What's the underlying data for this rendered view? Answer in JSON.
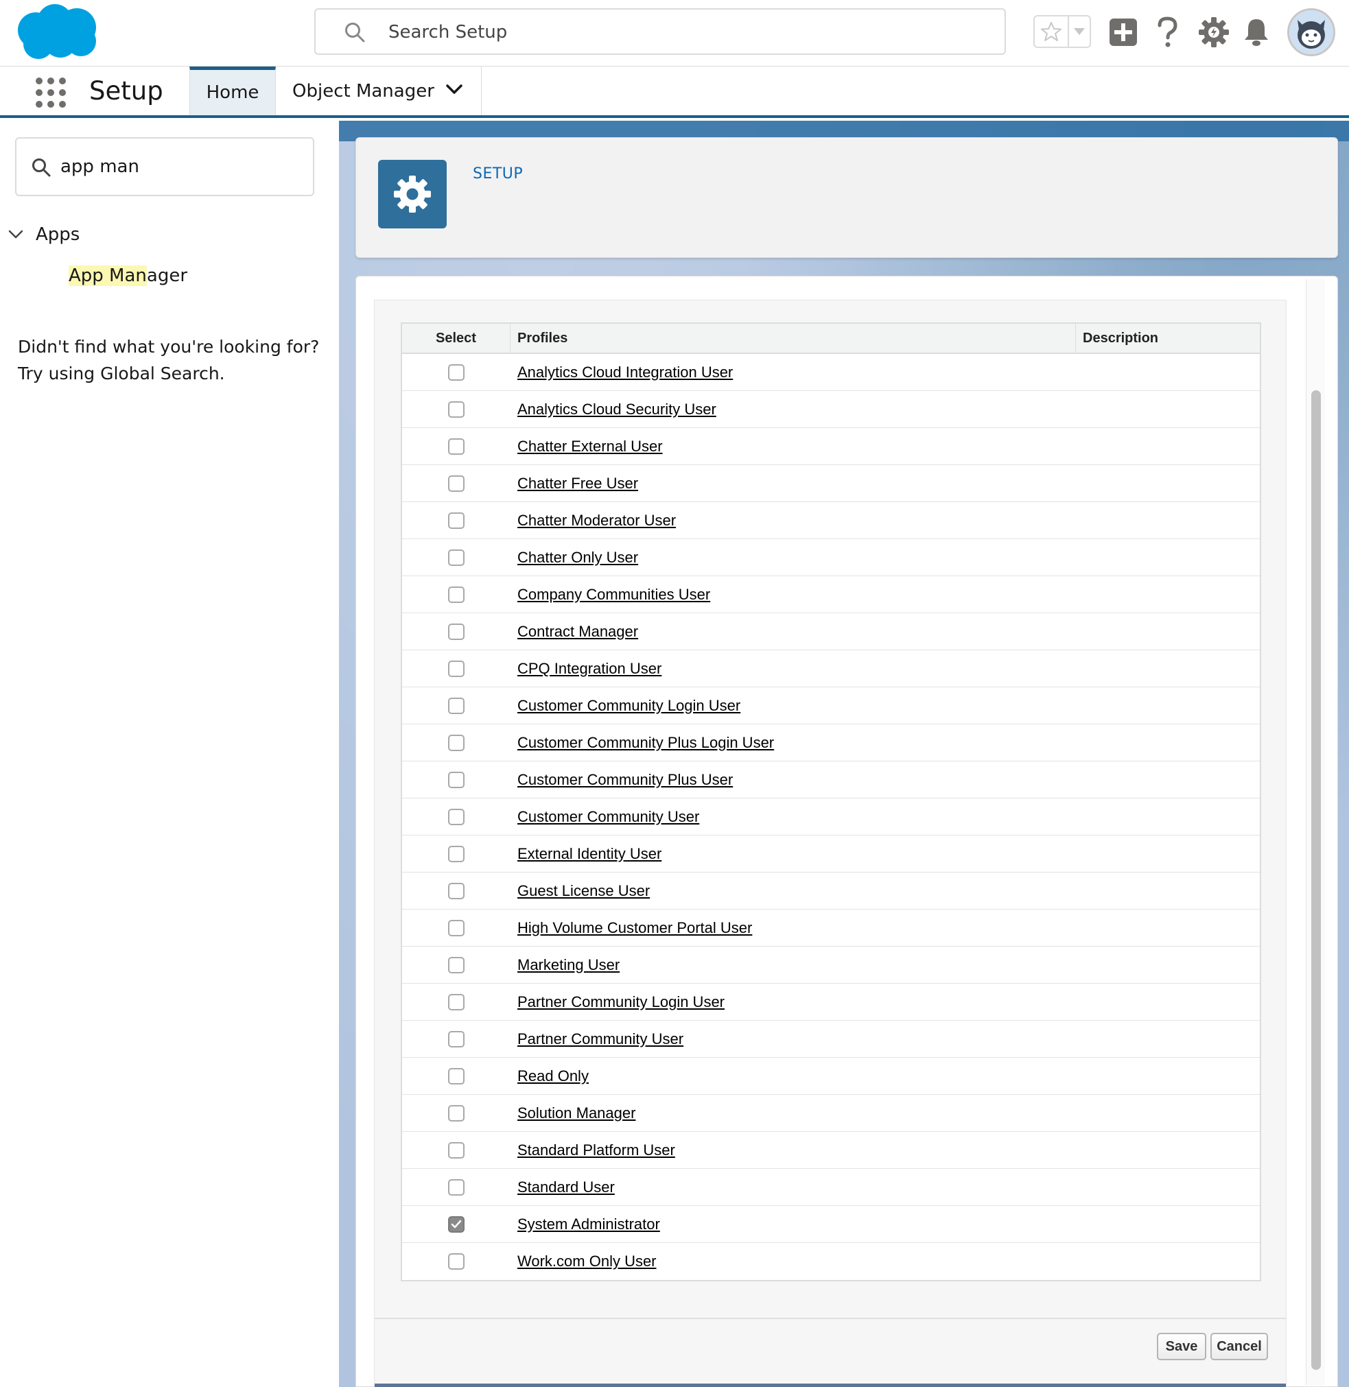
{
  "header": {
    "search_placeholder": "Search Setup",
    "brand_color": "#00a1e0",
    "icons": [
      "salesforce-logo",
      "search-icon",
      "star-icon",
      "chevron-down-icon",
      "plus-icon",
      "help-icon",
      "gear-icon",
      "bell-icon",
      "avatar"
    ]
  },
  "nav": {
    "app_name": "Setup",
    "tabs": [
      {
        "label": "Home",
        "active": true
      },
      {
        "label": "Object Manager",
        "active": false
      }
    ]
  },
  "sidebar": {
    "quick_find_value": "app man",
    "tree": {
      "section_label": "Apps",
      "item_highlight": "App Man",
      "item_rest": "ager"
    },
    "hint_line1": "Didn't find what you're looking for?",
    "hint_line2": "Try using Global Search."
  },
  "setup_header": {
    "breadcrumb": "SETUP"
  },
  "table": {
    "columns": [
      "Select",
      "Profiles",
      "Description"
    ],
    "rows": [
      {
        "profile": "Analytics Cloud Integration User",
        "checked": false
      },
      {
        "profile": "Analytics Cloud Security User",
        "checked": false
      },
      {
        "profile": "Chatter External User",
        "checked": false
      },
      {
        "profile": "Chatter Free User",
        "checked": false
      },
      {
        "profile": "Chatter Moderator User",
        "checked": false
      },
      {
        "profile": "Chatter Only User",
        "checked": false
      },
      {
        "profile": "Company Communities User",
        "checked": false
      },
      {
        "profile": "Contract Manager",
        "checked": false
      },
      {
        "profile": "CPQ Integration User",
        "checked": false
      },
      {
        "profile": "Customer Community Login User",
        "checked": false
      },
      {
        "profile": "Customer Community Plus Login User",
        "checked": false
      },
      {
        "profile": "Customer Community Plus User",
        "checked": false
      },
      {
        "profile": "Customer Community User",
        "checked": false
      },
      {
        "profile": "External Identity User",
        "checked": false
      },
      {
        "profile": "Guest License User",
        "checked": false
      },
      {
        "profile": "High Volume Customer Portal User",
        "checked": false
      },
      {
        "profile": "Marketing User",
        "checked": false
      },
      {
        "profile": "Partner Community Login User",
        "checked": false
      },
      {
        "profile": "Partner Community User",
        "checked": false
      },
      {
        "profile": "Read Only",
        "checked": false
      },
      {
        "profile": "Solution Manager",
        "checked": false
      },
      {
        "profile": "Standard Platform User",
        "checked": false
      },
      {
        "profile": "Standard User",
        "checked": false
      },
      {
        "profile": "System Administrator",
        "checked": true
      },
      {
        "profile": "Work.com Only User",
        "checked": false
      }
    ]
  },
  "footer": {
    "save_label": "Save",
    "cancel_label": "Cancel"
  }
}
